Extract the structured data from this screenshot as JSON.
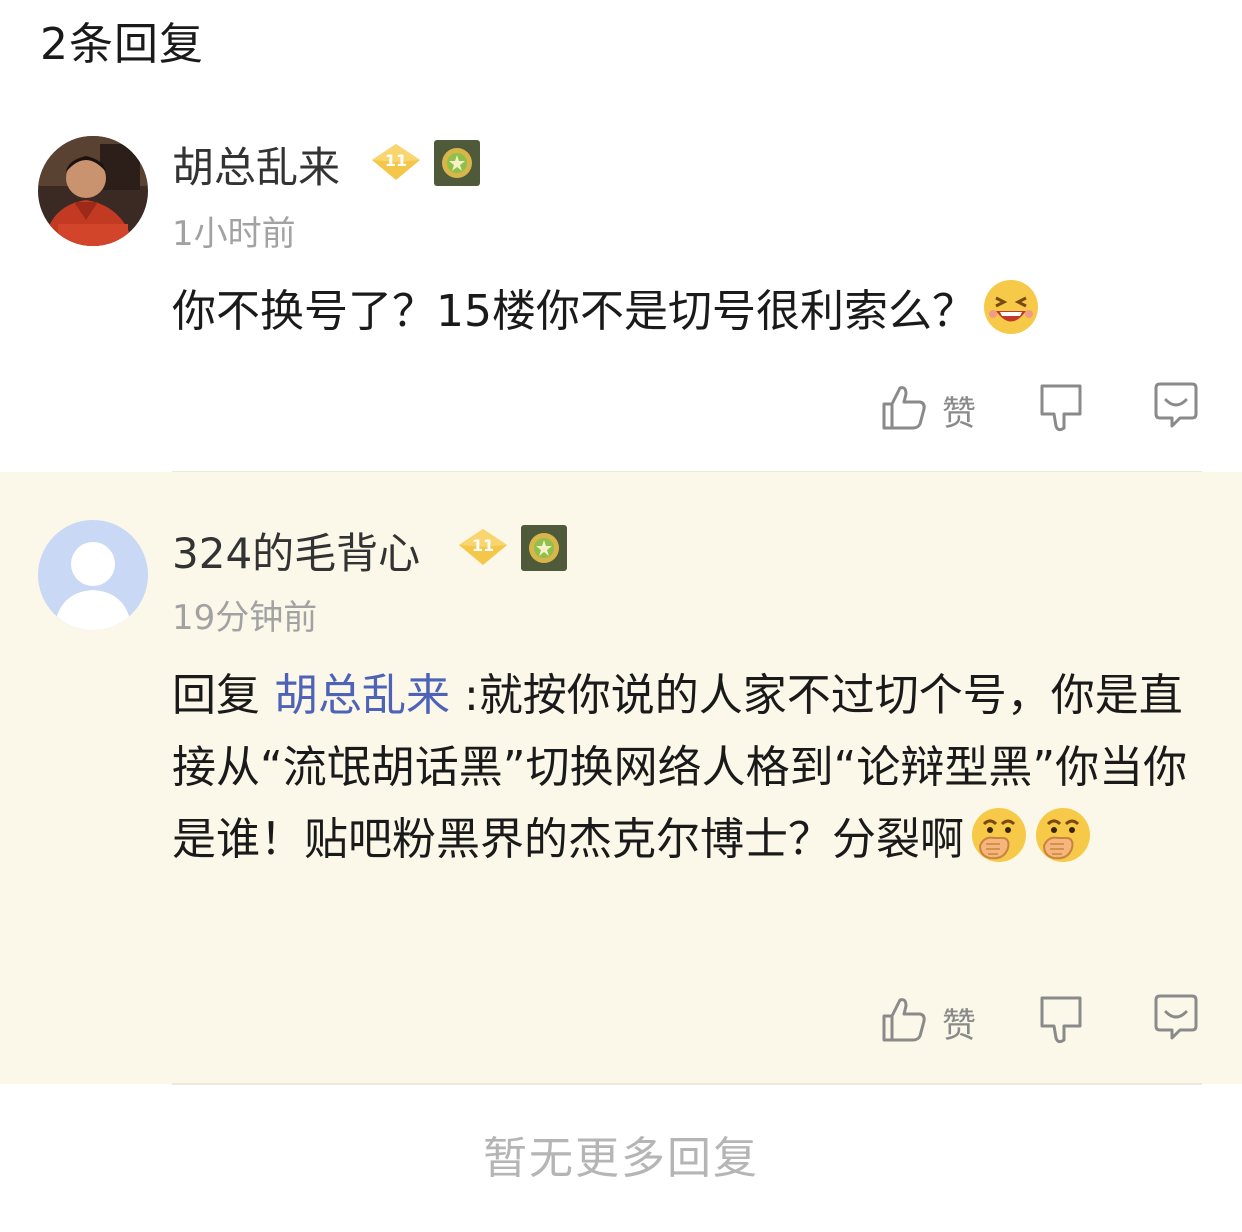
{
  "header": {
    "title": "2条回复"
  },
  "comments": [
    {
      "username": "胡总乱来",
      "level": "11",
      "timestamp": "1小时前",
      "text": "你不换号了？15楼你不是切号很利索么？",
      "emoji": "laughing-emoji",
      "actions": {
        "like_label": "赞"
      }
    },
    {
      "username": "324的毛背心",
      "level": "11",
      "timestamp": "19分钟前",
      "reply_prefix": "回复 ",
      "mention": "胡总乱来",
      "text": " :就按你说的人家不过切个号，你是直接从“流氓胡话黑”切换网络人格到“论辩型黑”你当你是谁！贴吧粉黑界的杰克尔博士？分裂啊",
      "emoji": "covering-mouth-emoji",
      "actions": {
        "like_label": "赞"
      }
    }
  ],
  "footer": {
    "note": "暂无更多回复"
  },
  "colors": {
    "mention": "#4e63b8",
    "highlight_bg": "#fbf8ea",
    "muted": "#a2a2a2"
  }
}
